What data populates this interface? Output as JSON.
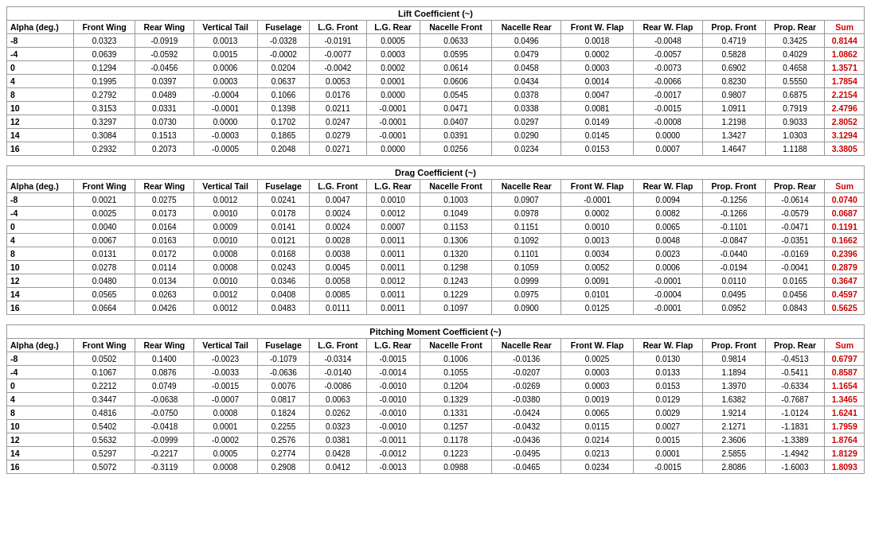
{
  "tables": [
    {
      "title": "Lift Coefficient (~)",
      "columns": [
        "Alpha (deg.)",
        "Front Wing",
        "Rear Wing",
        "Vertical Tail",
        "Fuselage",
        "L.G. Front",
        "L.G. Rear",
        "Nacelle Front",
        "Nacelle Rear",
        "Front W. Flap",
        "Rear W. Flap",
        "Prop. Front",
        "Prop. Rear",
        "Sum"
      ],
      "rows": [
        [
          "-8",
          "0.0323",
          "-0.0919",
          "0.0013",
          "-0.0328",
          "-0.0191",
          "0.0005",
          "0.0633",
          "0.0496",
          "0.0018",
          "-0.0048",
          "0.4719",
          "0.3425",
          "0.8144"
        ],
        [
          "-4",
          "0.0639",
          "-0.0592",
          "0.0015",
          "-0.0002",
          "-0.0077",
          "0.0003",
          "0.0595",
          "0.0479",
          "0.0002",
          "-0.0057",
          "0.5828",
          "0.4029",
          "1.0862"
        ],
        [
          "0",
          "0.1294",
          "-0.0456",
          "0.0006",
          "0.0204",
          "-0.0042",
          "0.0002",
          "0.0614",
          "0.0458",
          "0.0003",
          "-0.0073",
          "0.6902",
          "0.4658",
          "1.3571"
        ],
        [
          "4",
          "0.1995",
          "0.0397",
          "0.0003",
          "0.0637",
          "0.0053",
          "0.0001",
          "0.0606",
          "0.0434",
          "0.0014",
          "-0.0066",
          "0.8230",
          "0.5550",
          "1.7854"
        ],
        [
          "8",
          "0.2792",
          "0.0489",
          "-0.0004",
          "0.1066",
          "0.0176",
          "0.0000",
          "0.0545",
          "0.0378",
          "0.0047",
          "-0.0017",
          "0.9807",
          "0.6875",
          "2.2154"
        ],
        [
          "10",
          "0.3153",
          "0.0331",
          "-0.0001",
          "0.1398",
          "0.0211",
          "-0.0001",
          "0.0471",
          "0.0338",
          "0.0081",
          "-0.0015",
          "1.0911",
          "0.7919",
          "2.4796"
        ],
        [
          "12",
          "0.3297",
          "0.0730",
          "0.0000",
          "0.1702",
          "0.0247",
          "-0.0001",
          "0.0407",
          "0.0297",
          "0.0149",
          "-0.0008",
          "1.2198",
          "0.9033",
          "2.8052"
        ],
        [
          "14",
          "0.3084",
          "0.1513",
          "-0.0003",
          "0.1865",
          "0.0279",
          "-0.0001",
          "0.0391",
          "0.0290",
          "0.0145",
          "0.0000",
          "1.3427",
          "1.0303",
          "3.1294"
        ],
        [
          "16",
          "0.2932",
          "0.2073",
          "-0.0005",
          "0.2048",
          "0.0271",
          "0.0000",
          "0.0256",
          "0.0234",
          "0.0153",
          "0.0007",
          "1.4647",
          "1.1188",
          "3.3805"
        ]
      ]
    },
    {
      "title": "Drag Coefficient (~)",
      "columns": [
        "Alpha (deg.)",
        "Front Wing",
        "Rear Wing",
        "Vertical Tail",
        "Fuselage",
        "L.G. Front",
        "L.G. Rear",
        "Nacelle Front",
        "Nacelle Rear",
        "Front W. Flap",
        "Rear W. Flap",
        "Prop. Front",
        "Prop. Rear",
        "Sum"
      ],
      "rows": [
        [
          "-8",
          "0.0021",
          "0.0275",
          "0.0012",
          "0.0241",
          "0.0047",
          "0.0010",
          "0.1003",
          "0.0907",
          "-0.0001",
          "0.0094",
          "-0.1256",
          "-0.0614",
          "0.0740"
        ],
        [
          "-4",
          "0.0025",
          "0.0173",
          "0.0010",
          "0.0178",
          "0.0024",
          "0.0012",
          "0.1049",
          "0.0978",
          "0.0002",
          "0.0082",
          "-0.1266",
          "-0.0579",
          "0.0687"
        ],
        [
          "0",
          "0.0040",
          "0.0164",
          "0.0009",
          "0.0141",
          "0.0024",
          "0.0007",
          "0.1153",
          "0.1151",
          "0.0010",
          "0.0065",
          "-0.1101",
          "-0.0471",
          "0.1191"
        ],
        [
          "4",
          "0.0067",
          "0.0163",
          "0.0010",
          "0.0121",
          "0.0028",
          "0.0011",
          "0.1306",
          "0.1092",
          "0.0013",
          "0.0048",
          "-0.0847",
          "-0.0351",
          "0.1662"
        ],
        [
          "8",
          "0.0131",
          "0.0172",
          "0.0008",
          "0.0168",
          "0.0038",
          "0.0011",
          "0.1320",
          "0.1101",
          "0.0034",
          "0.0023",
          "-0.0440",
          "-0.0169",
          "0.2396"
        ],
        [
          "10",
          "0.0278",
          "0.0114",
          "0.0008",
          "0.0243",
          "0.0045",
          "0.0011",
          "0.1298",
          "0.1059",
          "0.0052",
          "0.0006",
          "-0.0194",
          "-0.0041",
          "0.2879"
        ],
        [
          "12",
          "0.0480",
          "0.0134",
          "0.0010",
          "0.0346",
          "0.0058",
          "0.0012",
          "0.1243",
          "0.0999",
          "0.0091",
          "-0.0001",
          "0.0110",
          "0.0165",
          "0.3647"
        ],
        [
          "14",
          "0.0565",
          "0.0263",
          "0.0012",
          "0.0408",
          "0.0085",
          "0.0011",
          "0.1229",
          "0.0975",
          "0.0101",
          "-0.0004",
          "0.0495",
          "0.0456",
          "0.4597"
        ],
        [
          "16",
          "0.0664",
          "0.0426",
          "0.0012",
          "0.0483",
          "0.0111",
          "0.0011",
          "0.1097",
          "0.0900",
          "0.0125",
          "-0.0001",
          "0.0952",
          "0.0843",
          "0.5625"
        ]
      ]
    },
    {
      "title": "Pitching Moment Coefficient (~)",
      "columns": [
        "Alpha (deg.)",
        "Front Wing",
        "Rear Wing",
        "Vertical Tail",
        "Fuselage",
        "L.G. Front",
        "L.G. Rear",
        "Nacelle Front",
        "Nacelle Rear",
        "Front W. Flap",
        "Rear W. Flap",
        "Prop. Front",
        "Prop. Rear",
        "Sum"
      ],
      "rows": [
        [
          "-8",
          "0.0502",
          "0.1400",
          "-0.0023",
          "-0.1079",
          "-0.0314",
          "-0.0015",
          "0.1006",
          "-0.0136",
          "0.0025",
          "0.0130",
          "0.9814",
          "-0.4513",
          "0.6797"
        ],
        [
          "-4",
          "0.1067",
          "0.0876",
          "-0.0033",
          "-0.0636",
          "-0.0140",
          "-0.0014",
          "0.1055",
          "-0.0207",
          "0.0003",
          "0.0133",
          "1.1894",
          "-0.5411",
          "0.8587"
        ],
        [
          "0",
          "0.2212",
          "0.0749",
          "-0.0015",
          "0.0076",
          "-0.0086",
          "-0.0010",
          "0.1204",
          "-0.0269",
          "0.0003",
          "0.0153",
          "1.3970",
          "-0.6334",
          "1.1654"
        ],
        [
          "4",
          "0.3447",
          "-0.0638",
          "-0.0007",
          "0.0817",
          "0.0063",
          "-0.0010",
          "0.1329",
          "-0.0380",
          "0.0019",
          "0.0129",
          "1.6382",
          "-0.7687",
          "1.3465"
        ],
        [
          "8",
          "0.4816",
          "-0.0750",
          "0.0008",
          "0.1824",
          "0.0262",
          "-0.0010",
          "0.1331",
          "-0.0424",
          "0.0065",
          "0.0029",
          "1.9214",
          "-1.0124",
          "1.6241"
        ],
        [
          "10",
          "0.5402",
          "-0.0418",
          "0.0001",
          "0.2255",
          "0.0323",
          "-0.0010",
          "0.1257",
          "-0.0432",
          "0.0115",
          "0.0027",
          "2.1271",
          "-1.1831",
          "1.7959"
        ],
        [
          "12",
          "0.5632",
          "-0.0999",
          "-0.0002",
          "0.2576",
          "0.0381",
          "-0.0011",
          "0.1178",
          "-0.0436",
          "0.0214",
          "0.0015",
          "2.3606",
          "-1.3389",
          "1.8764"
        ],
        [
          "14",
          "0.5297",
          "-0.2217",
          "0.0005",
          "0.2774",
          "0.0428",
          "-0.0012",
          "0.1223",
          "-0.0495",
          "0.0213",
          "0.0001",
          "2.5855",
          "-1.4942",
          "1.8129"
        ],
        [
          "16",
          "0.5072",
          "-0.3119",
          "0.0008",
          "0.2908",
          "0.0412",
          "-0.0013",
          "0.0988",
          "-0.0465",
          "0.0234",
          "-0.0015",
          "2.8086",
          "-1.6003",
          "1.8093"
        ]
      ]
    }
  ]
}
